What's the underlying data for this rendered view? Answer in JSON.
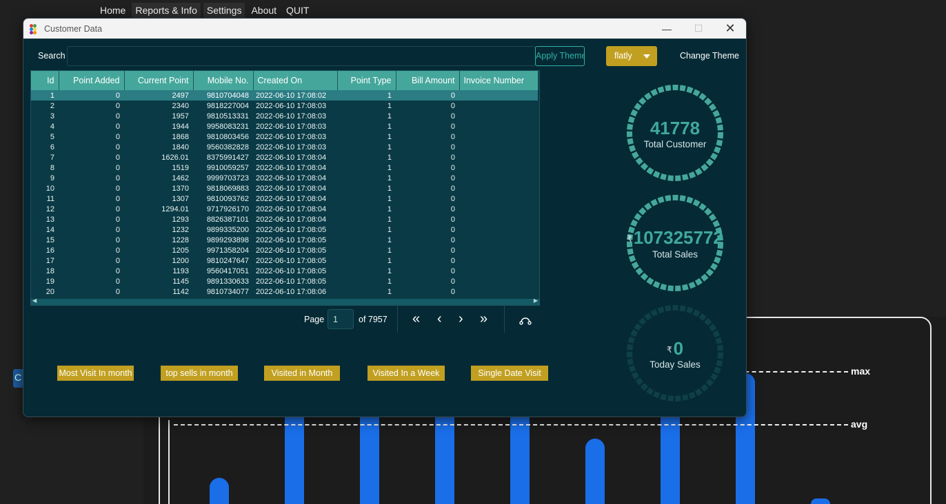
{
  "background": {
    "menu": [
      "Home",
      "Reports & Info",
      "Settings",
      "About",
      "QUIT"
    ],
    "side_tab_label": "C",
    "chart_lines": {
      "max_label": "max",
      "avg_label": "avg"
    },
    "chart_data": {
      "type": "bar",
      "series": [
        {
          "values": [
            38,
            140,
            140,
            140,
            140,
            95,
            140,
            190,
            8
          ]
        }
      ],
      "ref_lines": [
        "max",
        "avg"
      ]
    }
  },
  "window": {
    "title": "Customer Data",
    "controls": {
      "minimize": "—",
      "maximize": "☐",
      "close": "✕"
    }
  },
  "search": {
    "label": "Search",
    "value": ""
  },
  "theme": {
    "apply_label": "Apply Theme",
    "selected": "flatly",
    "change_label": "Change Theme"
  },
  "table": {
    "columns": [
      "Id",
      "Point Added",
      "Current Point",
      "Mobile No.",
      "Created On",
      "Point Type",
      "Bill Amount",
      "Invoice Number"
    ],
    "rows": [
      [
        "1",
        "0",
        "2497",
        "9810704048",
        "2022-06-10 17:08:02",
        "1",
        "0",
        ""
      ],
      [
        "2",
        "0",
        "2340",
        "9818227004",
        "2022-06-10 17:08:03",
        "1",
        "0",
        ""
      ],
      [
        "3",
        "0",
        "1957",
        "9810513331",
        "2022-06-10 17:08:03",
        "1",
        "0",
        ""
      ],
      [
        "4",
        "0",
        "1944",
        "9958083231",
        "2022-06-10 17:08:03",
        "1",
        "0",
        ""
      ],
      [
        "5",
        "0",
        "1868",
        "9810803456",
        "2022-06-10 17:08:03",
        "1",
        "0",
        ""
      ],
      [
        "6",
        "0",
        "1840",
        "9560382828",
        "2022-06-10 17:08:03",
        "1",
        "0",
        ""
      ],
      [
        "7",
        "0",
        "1626.01",
        "8375991427",
        "2022-06-10 17:08:04",
        "1",
        "0",
        ""
      ],
      [
        "8",
        "0",
        "1519",
        "9910059257",
        "2022-06-10 17:08:04",
        "1",
        "0",
        ""
      ],
      [
        "9",
        "0",
        "1462",
        "9999703723",
        "2022-06-10 17:08:04",
        "1",
        "0",
        ""
      ],
      [
        "10",
        "0",
        "1370",
        "9818069883",
        "2022-06-10 17:08:04",
        "1",
        "0",
        ""
      ],
      [
        "11",
        "0",
        "1307",
        "9810093762",
        "2022-06-10 17:08:04",
        "1",
        "0",
        ""
      ],
      [
        "12",
        "0",
        "1294.01",
        "9717926170",
        "2022-06-10 17:08:04",
        "1",
        "0",
        ""
      ],
      [
        "13",
        "0",
        "1293",
        "8826387101",
        "2022-06-10 17:08:04",
        "1",
        "0",
        ""
      ],
      [
        "14",
        "0",
        "1232",
        "9899335200",
        "2022-06-10 17:08:05",
        "1",
        "0",
        ""
      ],
      [
        "15",
        "0",
        "1228",
        "9899293898",
        "2022-06-10 17:08:05",
        "1",
        "0",
        ""
      ],
      [
        "16",
        "0",
        "1205",
        "9971358204",
        "2022-06-10 17:08:05",
        "1",
        "0",
        ""
      ],
      [
        "17",
        "0",
        "1200",
        "9810247647",
        "2022-06-10 17:08:05",
        "1",
        "0",
        ""
      ],
      [
        "18",
        "0",
        "1193",
        "9560417051",
        "2022-06-10 17:08:05",
        "1",
        "0",
        ""
      ],
      [
        "19",
        "0",
        "1145",
        "9891330633",
        "2022-06-10 17:08:05",
        "1",
        "0",
        ""
      ],
      [
        "20",
        "0",
        "1142",
        "9810734077",
        "2022-06-10 17:08:06",
        "1",
        "0",
        ""
      ]
    ]
  },
  "pagination": {
    "page_label": "Page",
    "current_page": "1",
    "of_label": "of 7957",
    "first": "«",
    "prev": "‹",
    "next": "›",
    "last": "»"
  },
  "reports": {
    "most_visit": "Most Visit In month",
    "top_sells": "top sells in month",
    "visited_month": "Visited in Month",
    "visited_week": "Visited In a Week",
    "single_date": "Single Date Visit"
  },
  "stats": {
    "total_customer": {
      "value": "41778",
      "label": "Total Customer"
    },
    "total_sales": {
      "currency": "₹",
      "value": "107325772",
      "label": "Total Sales"
    },
    "today_sales": {
      "currency": "₹",
      "value": "0",
      "label": "Today Sales"
    }
  },
  "colors": {
    "window_bg": "#052a35",
    "accent": "#45a79c",
    "gold": "#c1a021",
    "bar_blue": "#1a6ee8"
  }
}
